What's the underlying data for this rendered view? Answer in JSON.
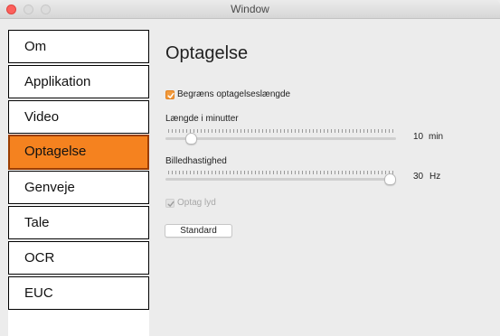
{
  "window": {
    "title": "Window"
  },
  "sidebar": {
    "items": [
      {
        "label": "Om"
      },
      {
        "label": "Applikation"
      },
      {
        "label": "Video"
      },
      {
        "label": "Optagelse"
      },
      {
        "label": "Genveje"
      },
      {
        "label": "Tale"
      },
      {
        "label": "OCR"
      },
      {
        "label": "EUC"
      }
    ],
    "selected": "Optagelse"
  },
  "main": {
    "heading": "Optagelse",
    "limit_checkbox": {
      "label": "Begræns optagelseslængde",
      "checked": true
    },
    "length_slider": {
      "label": "Længde i minutter",
      "value": "10",
      "unit": "min",
      "level": 0.09
    },
    "framerate_slider": {
      "label": "Billedhastighed",
      "value": "30",
      "unit": "Hz",
      "level": 1.0
    },
    "audio_checkbox": {
      "label": "Optag lyd",
      "checked": true,
      "disabled": true
    },
    "default_button": "Standard"
  },
  "colors": {
    "accent": "#f5821f",
    "selected_border": "#9a3d00",
    "checkbox": "#f29a3c",
    "close": "#fc605c"
  },
  "icons": {
    "close": "close-icon",
    "minimize": "minimize-icon",
    "zoom": "zoom-icon",
    "check": "checkmark-icon"
  }
}
